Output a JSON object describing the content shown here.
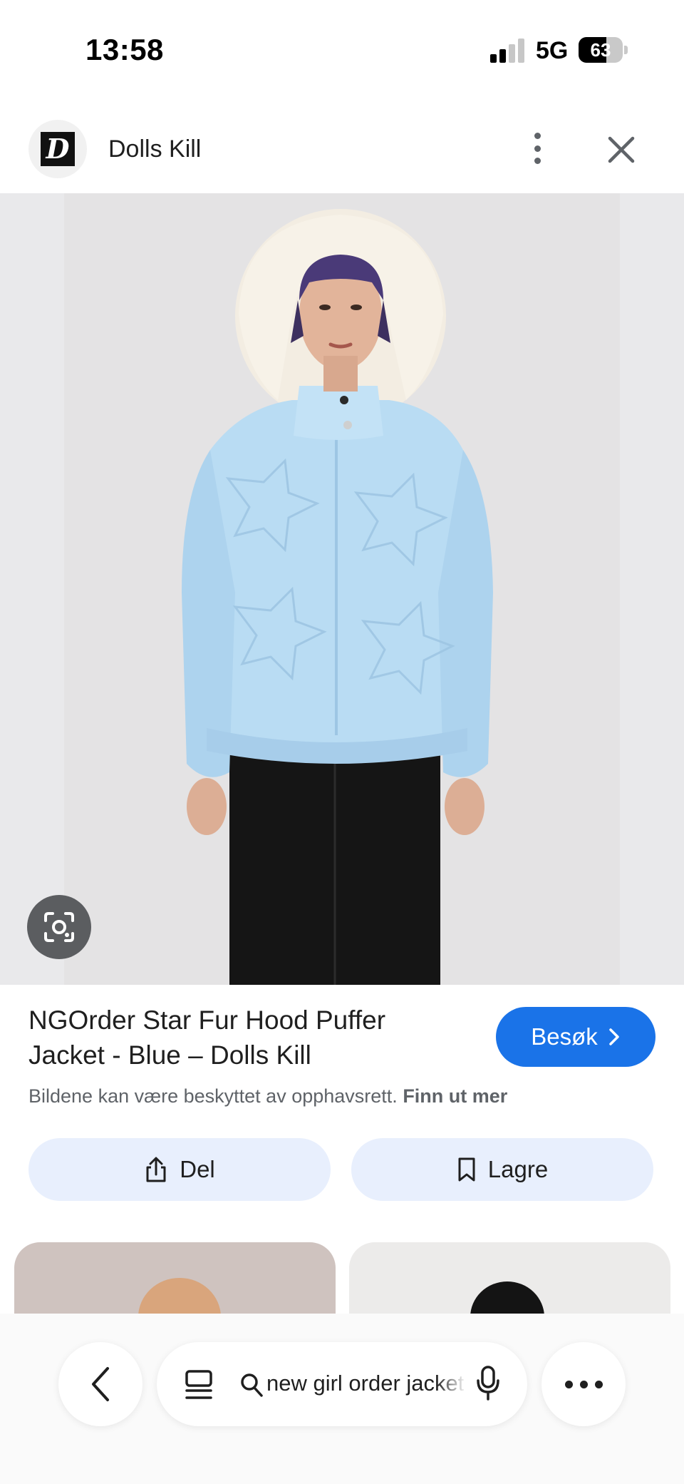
{
  "status_bar": {
    "time": "13:58",
    "network": "5G",
    "battery": "63",
    "battery_level": 0.63
  },
  "source": {
    "logo_letter": "D",
    "name": "Dolls Kill"
  },
  "result": {
    "title": "NGOrder Star Fur Hood Puffer Jacket - Blue – Dolls Kill",
    "visit_label": "Besøk",
    "copyright_text": "Bildene kan være beskyttet av opphavsrett.",
    "learn_more": "Finn ut mer"
  },
  "actions": {
    "share_label": "Del",
    "save_label": "Lagre"
  },
  "bottom_bar": {
    "search_query": "new girl order jacket"
  },
  "colors": {
    "accent": "#1a73e8",
    "action_bg": "#e8effd",
    "jacket": "#b9dcf3"
  },
  "icons": [
    "more-vert-icon",
    "close-icon",
    "lens-camera-icon",
    "chevron-right-icon",
    "share-icon",
    "bookmark-icon",
    "chevron-left-icon",
    "tabs-icon",
    "search-icon",
    "mic-icon",
    "more-horiz-icon"
  ]
}
